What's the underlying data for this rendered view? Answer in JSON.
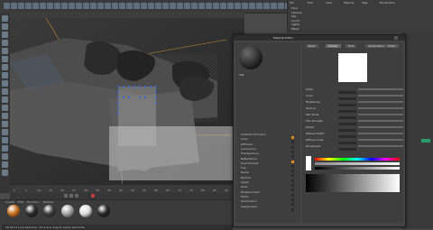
{
  "object_manager": {
    "menu": [
      "File",
      "Edit",
      "View",
      "Objects",
      "Tags",
      "Bookmarks"
    ],
    "rows": [
      "Floor",
      "Camera",
      "Sky",
      "Couch",
      "Lights",
      "Pillow"
    ]
  },
  "material_editor": {
    "title": "Material Editor",
    "material_name": "Mat",
    "channels": [
      {
        "label": "Ambient Occlusion",
        "checked": true
      },
      {
        "label": "Color",
        "checked": false
      },
      {
        "label": "Diffusion",
        "checked": false
      },
      {
        "label": "Luminance",
        "checked": false
      },
      {
        "label": "Transparency",
        "checked": false
      },
      {
        "label": "Reflectance",
        "checked": true
      },
      {
        "label": "Environment",
        "checked": false
      },
      {
        "label": "Fog",
        "checked": false
      },
      {
        "label": "Bump",
        "checked": false
      },
      {
        "label": "Normal",
        "checked": false
      },
      {
        "label": "Alpha",
        "checked": false
      },
      {
        "label": "Glow",
        "checked": false
      },
      {
        "label": "Displacement",
        "checked": false
      },
      {
        "label": "Editor",
        "checked": false
      },
      {
        "label": "Illumination",
        "checked": false
      },
      {
        "label": "Assignment",
        "checked": false
      }
    ],
    "tabs": [
      "Basic",
      "Shader",
      "Grid",
      "Illumination",
      "Editor"
    ],
    "layers": [
      "Layer 1",
      "Layer 2",
      "Layer 3",
      "Layer 4",
      "Layer 5",
      "Layer 6",
      "Layer 7"
    ],
    "properties": [
      "Mode",
      "Color",
      "Brightness",
      "Texture",
      "Mix Mode",
      "Mix Strength",
      "Model",
      "Diffuse Falloff",
      "Diffuse Level",
      "Roughness"
    ]
  },
  "material_manager": {
    "menu": [
      "Create",
      "Edit",
      "Function",
      "Texture"
    ],
    "balls": [
      {
        "color": "#c8711e"
      },
      {
        "color": "#2b2b2b"
      },
      {
        "color": "#3c3c3c"
      },
      {
        "color": "#a9a9a9"
      },
      {
        "color": "#e0e0e0"
      },
      {
        "color": "#262626"
      }
    ]
  },
  "timeline": {
    "frames": [
      "0",
      "5",
      "10",
      "15",
      "20",
      "25",
      "30",
      "35",
      "40",
      "45",
      "50",
      "55",
      "60",
      "65",
      "70",
      "75",
      "80",
      "85",
      "90"
    ]
  },
  "status": {
    "text": "00:00:11 Live Selection: Click and drag to select elements."
  },
  "colors": {
    "accent": "#e08a1c",
    "panel": "#3c3c3c",
    "viewport": "#2f2f2f"
  }
}
